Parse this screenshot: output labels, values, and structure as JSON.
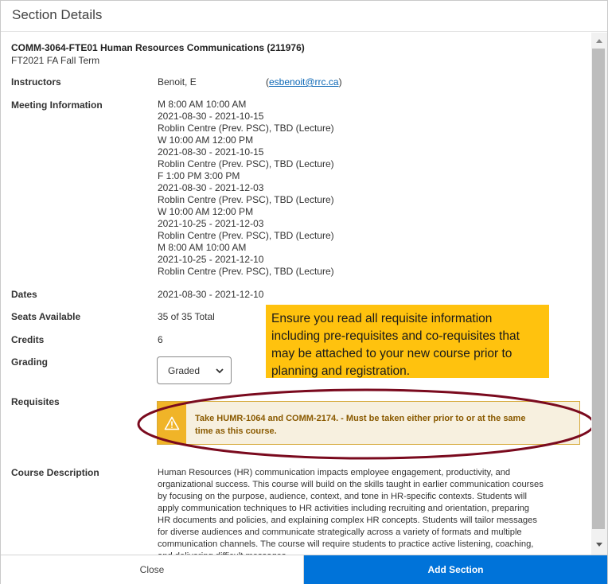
{
  "dialog": {
    "title": "Section Details"
  },
  "course": {
    "heading": "COMM-3064-FTE01 Human Resources Communications (211976)",
    "term": "FT2021 FA Fall Term"
  },
  "labels": {
    "instructors": "Instructors",
    "meeting": "Meeting Information",
    "dates": "Dates",
    "seats": "Seats Available",
    "credits": "Credits",
    "grading": "Grading",
    "requisites": "Requisites",
    "description": "Course Description"
  },
  "instructor": {
    "name": "Benoit, E",
    "email_open": "(",
    "email": "esbenoit@rrc.ca",
    "email_close": ")"
  },
  "meeting_lines": [
    "M 8:00 AM 10:00 AM",
    "2021-08-30 - 2021-10-15",
    "Roblin Centre (Prev. PSC), TBD (Lecture)",
    "W 10:00 AM 12:00 PM",
    "2021-08-30 - 2021-10-15",
    "Roblin Centre (Prev. PSC), TBD (Lecture)",
    "F 1:00 PM 3:00 PM",
    "2021-08-30 - 2021-12-03",
    "Roblin Centre (Prev. PSC), TBD (Lecture)",
    "W 10:00 AM 12:00 PM",
    "2021-10-25 - 2021-12-03",
    "Roblin Centre (Prev. PSC), TBD (Lecture)",
    "M 8:00 AM 10:00 AM",
    "2021-10-25 - 2021-12-10",
    "Roblin Centre (Prev. PSC), TBD (Lecture)"
  ],
  "dates": "2021-08-30 - 2021-12-10",
  "seats": "35 of 35 Total",
  "credits": "6",
  "grading": {
    "selected": "Graded"
  },
  "callout_lines": [
    "Ensure you read all requisite information",
    "including pre-requisites and co-requisites that",
    "may be attached to your new course prior to",
    "planning and registration."
  ],
  "requisite_lines": [
    "Take HUMR-1064 and COMM-2174. - Must be taken either prior to or at the same",
    "time as this course."
  ],
  "description_lines": [
    "Human Resources (HR) communication impacts employee engagement, productivity, and",
    "organizational success. This course will build on the skills taught in earlier communication courses",
    "by focusing on the purpose, audience, context, and tone in HR-specific contexts. Students will",
    "apply communication techniques to HR activities including recruiting and orientation, preparing",
    "HR documents and policies, and explaining complex HR concepts. Students will tailor messages",
    "for diverse audiences and communicate strategically across a variety of formats and multiple",
    "communication channels. The course will require students to practice active listening, coaching,",
    "and delivering difficult messages."
  ],
  "footer": {
    "close_label": "Close",
    "add_label": "Add Section"
  },
  "colors": {
    "primary_button": "#0073d9",
    "callout": "#ffc20e",
    "warning": "#f0b428",
    "ellipse": "#7a0a1e"
  },
  "icons": {
    "warning": "warning-triangle-icon",
    "dropdown": "chevron-down-icon",
    "scroll_up": "scroll-up-arrow-icon",
    "scroll_down": "scroll-down-arrow-icon"
  }
}
